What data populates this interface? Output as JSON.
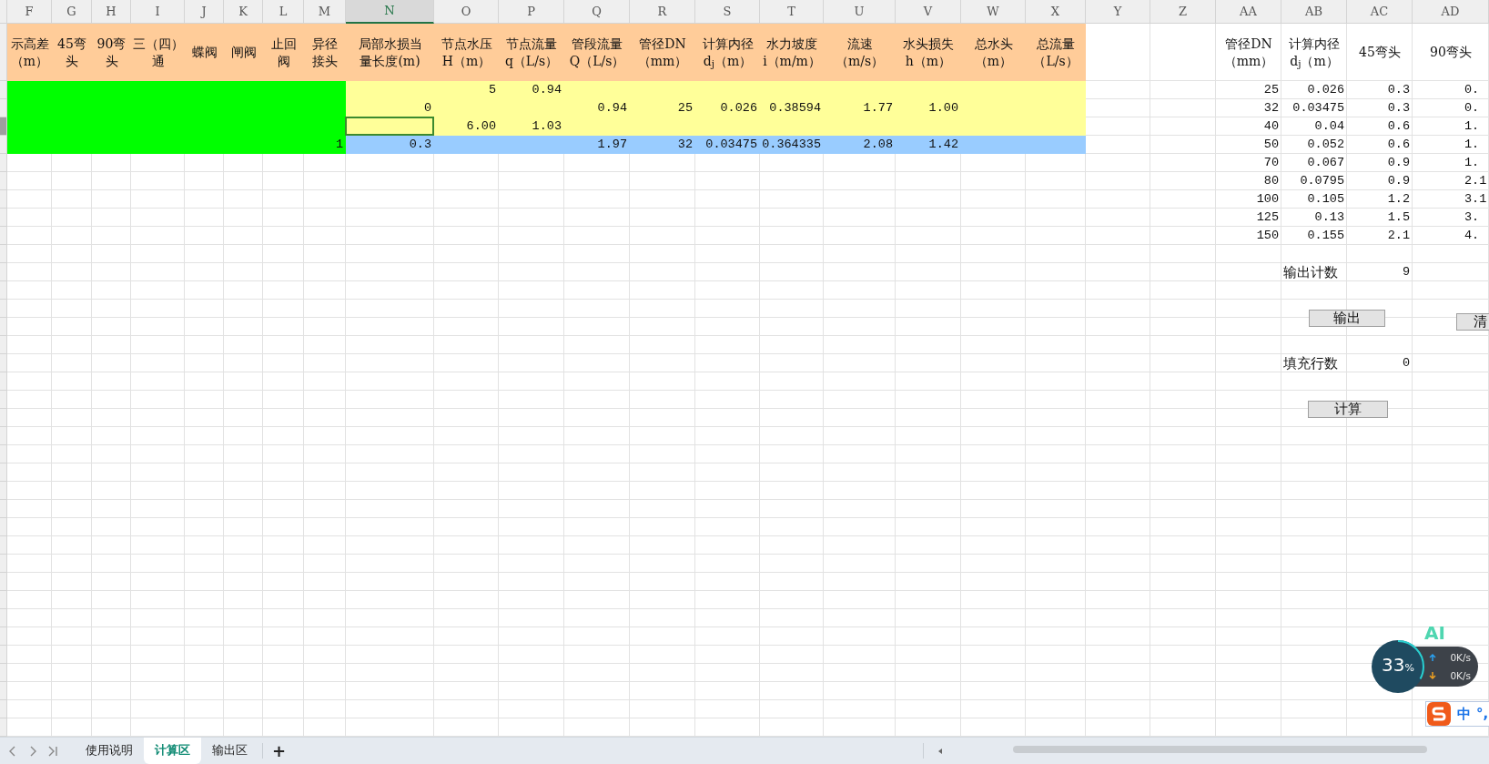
{
  "columns": [
    {
      "letter": "F",
      "selected": false,
      "header": [
        "示高差",
        "（m）"
      ]
    },
    {
      "letter": "G",
      "selected": false,
      "header": [
        "45弯",
        "头"
      ]
    },
    {
      "letter": "H",
      "selected": false,
      "header": [
        "90弯",
        "头"
      ]
    },
    {
      "letter": "I",
      "selected": false,
      "header": [
        "三（四）",
        "通"
      ]
    },
    {
      "letter": "J",
      "selected": false,
      "header": [
        "蝶阀"
      ]
    },
    {
      "letter": "K",
      "selected": false,
      "header": [
        "闸阀"
      ]
    },
    {
      "letter": "L",
      "selected": false,
      "header": [
        "止回",
        "阀"
      ]
    },
    {
      "letter": "M",
      "selected": false,
      "header": [
        "异径",
        "接头"
      ]
    },
    {
      "letter": "N",
      "selected": true,
      "header": [
        "局部水损当",
        "量长度(m)"
      ]
    },
    {
      "letter": "O",
      "selected": false,
      "header": [
        "节点水压",
        "H（m）"
      ]
    },
    {
      "letter": "P",
      "selected": false,
      "header": [
        "节点流量",
        "q（L/s）"
      ]
    },
    {
      "letter": "Q",
      "selected": false,
      "header": [
        "管段流量",
        "Q（L/s）"
      ]
    },
    {
      "letter": "R",
      "selected": false,
      "header": [
        "管径DN",
        "（mm）"
      ]
    },
    {
      "letter": "S",
      "selected": false,
      "header": [
        "计算内径",
        "d$_{j}$（m）"
      ]
    },
    {
      "letter": "T",
      "selected": false,
      "header": [
        "水力坡度",
        "i（m/m）"
      ]
    },
    {
      "letter": "U",
      "selected": false,
      "header": [
        "流速",
        "（m/s）"
      ]
    },
    {
      "letter": "V",
      "selected": false,
      "header": [
        "水头损失",
        "h（m）"
      ]
    },
    {
      "letter": "W",
      "selected": false,
      "header": [
        "总水头",
        "（m）"
      ]
    },
    {
      "letter": "X",
      "selected": false,
      "header": [
        "总流量",
        "（L/s）"
      ]
    },
    {
      "letter": "Y",
      "selected": false
    },
    {
      "letter": "Z",
      "selected": false
    },
    {
      "letter": "AA",
      "selected": false,
      "header": [
        "管径DN",
        "（mm）"
      ]
    },
    {
      "letter": "AB",
      "selected": false,
      "header": [
        "计算内径",
        "d$_{j}$（m）"
      ]
    },
    {
      "letter": "AC",
      "selected": false,
      "header": [
        "45弯头"
      ]
    },
    {
      "letter": "AD",
      "selected": false,
      "header": [
        "90弯头"
      ]
    }
  ],
  "data_rows": [
    {
      "color": "#ffff99",
      "selected": false,
      "cells": {
        "O": "5",
        "P": "0.94"
      }
    },
    {
      "color": "#ffff99",
      "selected": false,
      "cells": {
        "N": "0",
        "Q": "0.94",
        "R": "25",
        "S": "0.026",
        "T": "0.38594",
        "U": "1.77",
        "V": "1.00"
      }
    },
    {
      "color": "#ffff99",
      "selected": true,
      "cells": {
        "O": "6.00",
        "P": "1.03"
      }
    },
    {
      "color": "#99ccff",
      "selected": false,
      "cells": {
        "M": "1",
        "N": "0.3",
        "Q": "1.97",
        "R": "32",
        "S": "0.03475",
        "T": "0.364335",
        "U": "2.08",
        "V": "1.42"
      }
    }
  ],
  "lookup_table": {
    "rows": [
      [
        "25",
        "0.026",
        "0.3",
        "0."
      ],
      [
        "32",
        "0.03475",
        "0.3",
        "0."
      ],
      [
        "40",
        "0.04",
        "0.6",
        "1."
      ],
      [
        "50",
        "0.052",
        "0.6",
        "1."
      ],
      [
        "70",
        "0.067",
        "0.9",
        "1."
      ],
      [
        "80",
        "0.0795",
        "0.9",
        "2.1"
      ],
      [
        "100",
        "0.105",
        "1.2",
        "3.1"
      ],
      [
        "125",
        "0.13",
        "1.5",
        "3."
      ],
      [
        "150",
        "0.155",
        "2.1",
        "4."
      ]
    ]
  },
  "output_count": {
    "label": "输出计数",
    "value": "9"
  },
  "output_button": "输出",
  "clear_button": "清",
  "fill_rows": {
    "label": "填充行数",
    "value": "0"
  },
  "calculate_button": "计算",
  "sheet_tabs": [
    {
      "label": "使用说明",
      "selected": false
    },
    {
      "label": "计算区",
      "selected": true
    },
    {
      "label": "输出区",
      "selected": false
    }
  ],
  "add_sheet_button": "+",
  "speed_widget": {
    "badge": "AI",
    "usage": "33",
    "unit": "%",
    "level": 0.33,
    "upload": "0K/s",
    "download": "0K/s"
  },
  "ime_toolbar": {
    "mode": "中",
    "punctuation": "°,"
  }
}
